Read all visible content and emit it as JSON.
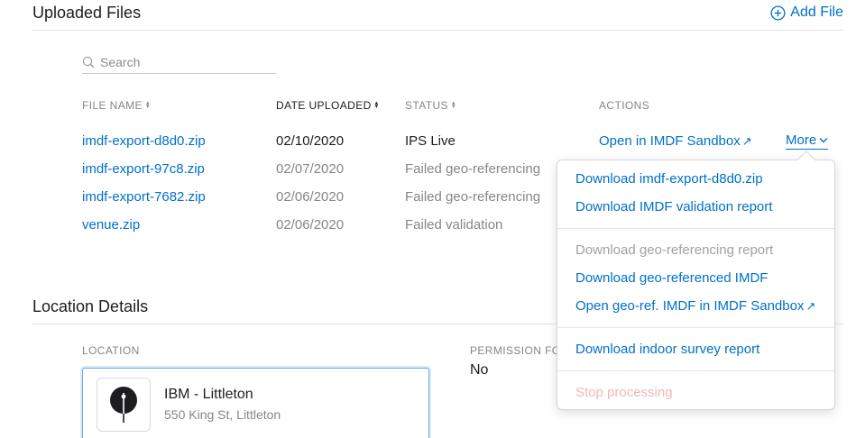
{
  "uploaded": {
    "title": "Uploaded Files",
    "add_file_label": "Add File",
    "search_placeholder": "Search",
    "columns": {
      "file_name": "FILE NAME",
      "date_uploaded": "DATE UPLOADED",
      "status": "STATUS",
      "actions": "ACTIONS"
    },
    "rows": [
      {
        "file": "imdf-export-d8d0.zip",
        "date": "02/10/2020",
        "status": "IPS Live"
      },
      {
        "file": "imdf-export-97c8.zip",
        "date": "02/07/2020",
        "status": "Failed geo-referencing"
      },
      {
        "file": "imdf-export-7682.zip",
        "date": "02/06/2020",
        "status": "Failed geo-referencing"
      },
      {
        "file": "venue.zip",
        "date": "02/06/2020",
        "status": "Failed validation"
      }
    ],
    "action_open_sandbox": "Open in IMDF Sandbox",
    "more_label": "More"
  },
  "more_menu": {
    "items": [
      {
        "label": "Download imdf-export-d8d0.zip",
        "state": "enabled"
      },
      {
        "label": "Download IMDF validation report",
        "state": "enabled"
      },
      {
        "label": "Download geo-referencing report",
        "state": "disabled"
      },
      {
        "label": "Download geo-referenced IMDF",
        "state": "enabled"
      },
      {
        "label": "Open geo-ref. IMDF in IMDF Sandbox",
        "state": "enabled"
      },
      {
        "label": "Download indoor survey report",
        "state": "enabled"
      },
      {
        "label": "Stop processing",
        "state": "disabled"
      }
    ]
  },
  "location_details": {
    "title": "Location Details",
    "location_label": "LOCATION",
    "permission_label": "PERMISSION FO",
    "permission_value": "No",
    "location_name": "IBM - Littleton",
    "location_address": "550 King St, Littleton"
  },
  "colors": {
    "accent": "#0070c9",
    "muted_text": "#86868b",
    "disabled_red": "#f2b8b8"
  },
  "icons": {
    "add": "plus-circle-icon",
    "search": "magnifier-icon",
    "sort": "sort-arrows-icon",
    "external": "arrow-up-right-icon",
    "chevron": "chevron-down-icon",
    "location": "map-pin-icon"
  }
}
